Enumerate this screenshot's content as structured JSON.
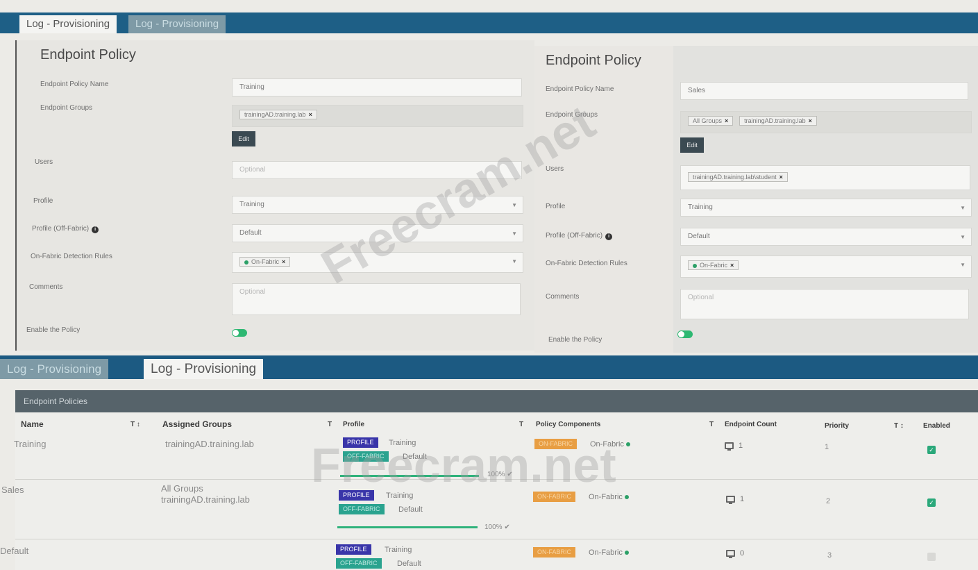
{
  "top": {
    "tabs": [
      "Log - Provisioning",
      "Log - Provisioning"
    ],
    "left": {
      "title": "Endpoint Policy",
      "labels": {
        "name": "Endpoint Policy Name",
        "groups": "Endpoint Groups",
        "users": "Users",
        "profile": "Profile",
        "profile_off": "Profile (Off-Fabric)",
        "rules": "On-Fabric Detection Rules",
        "comments": "Comments",
        "enable": "Enable the Policy"
      },
      "name_value": "Training",
      "groups_chip": "trainingAD.training.lab",
      "edit_label": "Edit",
      "users_placeholder": "Optional",
      "profile_value": "Training",
      "profile_off_value": "Default",
      "rules_chip": "On-Fabric",
      "comments_placeholder": "Optional"
    },
    "right": {
      "title": "Endpoint Policy",
      "labels": {
        "name": "Endpoint Policy Name",
        "groups": "Endpoint Groups",
        "users": "Users",
        "profile": "Profile",
        "profile_off": "Profile (Off-Fabric)",
        "rules": "On-Fabric Detection Rules",
        "comments": "Comments",
        "enable": "Enable the Policy"
      },
      "name_value": "Sales",
      "groups_chip1": "All Groups",
      "groups_chip2": "trainingAD.training.lab",
      "edit_label": "Edit",
      "users_chip": "trainingAD.training.lab\\student",
      "profile_value": "Training",
      "profile_off_value": "Default",
      "rules_chip": "On-Fabric",
      "comments_placeholder": "Optional"
    }
  },
  "bottom": {
    "tabs": [
      "Log - Provisioning",
      "Log - Provisioning"
    ],
    "table_title": "Endpoint Policies",
    "columns": {
      "name": "Name",
      "groups": "Assigned Groups",
      "profile": "Profile",
      "components": "Policy Components",
      "count": "Endpoint Count",
      "priority": "Priority",
      "enabled": "Enabled"
    },
    "filter_icon": "T",
    "sort_icon": "↕",
    "rows": [
      {
        "name": "Training",
        "groups": [
          "trainingAD.training.lab"
        ],
        "profile_badge": "PROFILE",
        "profile": "Training",
        "off_badge": "OFF-FABRIC",
        "off_profile": "Default",
        "progress": "100%",
        "on_badge": "ON-FABRIC",
        "component": "On-Fabric",
        "count": "1",
        "priority": "1",
        "enabled": true
      },
      {
        "name": "Sales",
        "groups": [
          "All Groups",
          "trainingAD.training.lab"
        ],
        "profile_badge": "PROFILE",
        "profile": "Training",
        "off_badge": "OFF-FABRIC",
        "off_profile": "Default",
        "progress": "100%",
        "on_badge": "ON-FABRIC",
        "component": "On-Fabric",
        "count": "1",
        "priority": "2",
        "enabled": true
      },
      {
        "name": "Default",
        "groups": [],
        "profile_badge": "PROFILE",
        "profile": "Training",
        "off_badge": "OFF-FABRIC",
        "off_profile": "Default",
        "on_badge": "ON-FABRIC",
        "component": "On-Fabric",
        "count": "0",
        "priority": "3",
        "enabled": false
      }
    ]
  },
  "watermark": [
    "Freecram.net",
    "Freecram.net"
  ]
}
